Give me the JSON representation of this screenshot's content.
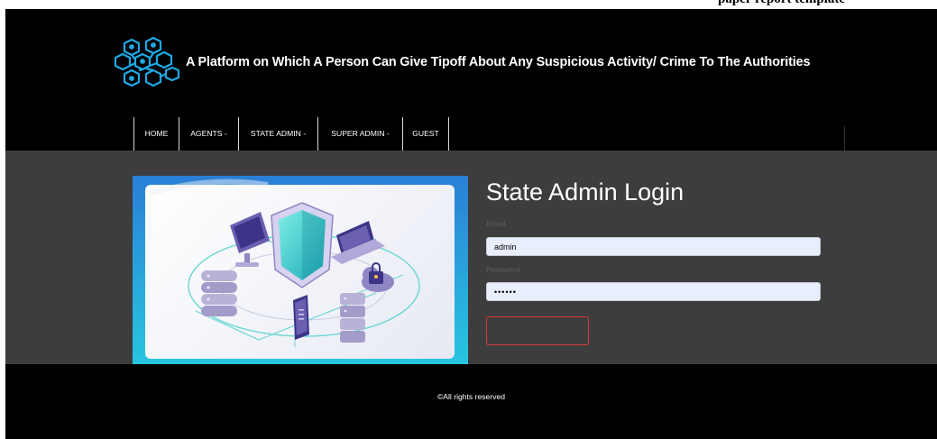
{
  "doc_fragment": "paper report template",
  "header": {
    "tagline": "A Platform on Which A Person Can Give Tipoff About Any Suspicious Activity/ Crime To The Authorities"
  },
  "nav": {
    "items": [
      {
        "label": "HOME"
      },
      {
        "label": "AGENTS -"
      },
      {
        "label": "STATE ADMIN -"
      },
      {
        "label": "SUPER ADMIN -"
      },
      {
        "label": "GUEST"
      }
    ]
  },
  "login": {
    "title": "State Admin Login",
    "email_label": "Email",
    "email_value": "admin",
    "password_label": "Password",
    "password_value": "••••••",
    "submit_label": ""
  },
  "footer": {
    "copyright": "©All rights reserved"
  },
  "colors": {
    "page_bg": "#000000",
    "main_bg": "#3d3d3d",
    "input_bg": "#e9eefc",
    "button_border": "#d73a3a",
    "logo_cyan": "#1ea9e6"
  },
  "icons": {
    "logo": "blockchain-cubes-icon",
    "hero": "cyber-security-shield-illustration"
  }
}
